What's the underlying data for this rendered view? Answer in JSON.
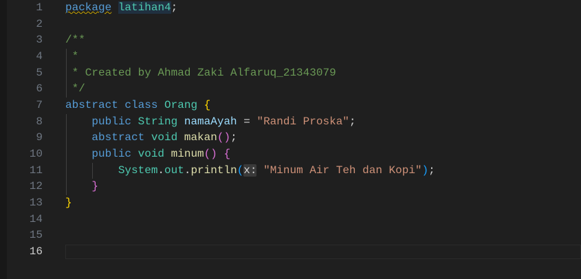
{
  "colors": {
    "keyword": "#569cd6",
    "type": "#4ec9b0",
    "variable": "#9cdcfe",
    "function": "#dcdcaa",
    "string": "#ce9178",
    "comment": "#6a9955",
    "plain": "#d4d4d4",
    "brace1": "#ffd700",
    "brace2": "#da70d6",
    "brace3": "#179fff"
  },
  "editor": {
    "active_line": 16,
    "lines": [
      {
        "n": "1",
        "tokens": [
          {
            "t": "package",
            "c": "keyword",
            "s": "squig"
          },
          {
            "t": " ",
            "c": "plain"
          },
          {
            "t": "latihan4",
            "c": "type",
            "s": "hl"
          },
          {
            "t": ";",
            "c": "plain"
          }
        ]
      },
      {
        "n": "2",
        "tokens": []
      },
      {
        "n": "3",
        "tokens": [
          {
            "t": "/**",
            "c": "comment"
          }
        ]
      },
      {
        "n": "4",
        "tokens": [
          {
            "t": " *",
            "c": "comment"
          }
        ]
      },
      {
        "n": "5",
        "tokens": [
          {
            "t": " * Created by Ahmad Zaki Alfaruq_21343079",
            "c": "comment"
          }
        ]
      },
      {
        "n": "6",
        "tokens": [
          {
            "t": " */",
            "c": "comment"
          }
        ]
      },
      {
        "n": "7",
        "tokens": [
          {
            "t": "abstract",
            "c": "keyword"
          },
          {
            "t": " ",
            "c": "plain"
          },
          {
            "t": "class",
            "c": "keyword"
          },
          {
            "t": " ",
            "c": "plain"
          },
          {
            "t": "Orang",
            "c": "type"
          },
          {
            "t": " ",
            "c": "plain"
          },
          {
            "t": "{",
            "c": "brace1"
          }
        ]
      },
      {
        "n": "8",
        "tokens": [
          {
            "t": "    ",
            "c": "plain"
          },
          {
            "t": "public",
            "c": "keyword"
          },
          {
            "t": " ",
            "c": "plain"
          },
          {
            "t": "String",
            "c": "type"
          },
          {
            "t": " ",
            "c": "plain"
          },
          {
            "t": "namaAyah",
            "c": "variable"
          },
          {
            "t": " = ",
            "c": "plain"
          },
          {
            "t": "\"Randi Proska\"",
            "c": "string"
          },
          {
            "t": ";",
            "c": "plain"
          }
        ]
      },
      {
        "n": "9",
        "tokens": [
          {
            "t": "    ",
            "c": "plain"
          },
          {
            "t": "abstract",
            "c": "keyword"
          },
          {
            "t": " ",
            "c": "plain"
          },
          {
            "t": "void",
            "c": "type"
          },
          {
            "t": " ",
            "c": "plain"
          },
          {
            "t": "makan",
            "c": "function"
          },
          {
            "t": "()",
            "c": "brace2"
          },
          {
            "t": ";",
            "c": "plain"
          }
        ]
      },
      {
        "n": "10",
        "tokens": [
          {
            "t": "    ",
            "c": "plain"
          },
          {
            "t": "public",
            "c": "keyword"
          },
          {
            "t": " ",
            "c": "plain"
          },
          {
            "t": "void",
            "c": "type"
          },
          {
            "t": " ",
            "c": "plain"
          },
          {
            "t": "minum",
            "c": "function"
          },
          {
            "t": "()",
            "c": "brace2"
          },
          {
            "t": " ",
            "c": "plain"
          },
          {
            "t": "{",
            "c": "brace2"
          }
        ]
      },
      {
        "n": "11",
        "tokens": [
          {
            "t": "        ",
            "c": "plain"
          },
          {
            "t": "System",
            "c": "type"
          },
          {
            "t": ".",
            "c": "plain"
          },
          {
            "t": "out",
            "c": "type"
          },
          {
            "t": ".",
            "c": "plain"
          },
          {
            "t": "println",
            "c": "function"
          },
          {
            "t": "(",
            "c": "brace3"
          },
          {
            "t": "x:",
            "c": "plain",
            "s": "hint"
          },
          {
            "t": " ",
            "c": "plain"
          },
          {
            "t": "\"Minum Air Teh dan Kopi\"",
            "c": "string"
          },
          {
            "t": ")",
            "c": "brace3"
          },
          {
            "t": ";",
            "c": "plain"
          }
        ]
      },
      {
        "n": "12",
        "tokens": [
          {
            "t": "    ",
            "c": "plain"
          },
          {
            "t": "}",
            "c": "brace2"
          }
        ]
      },
      {
        "n": "13",
        "tokens": [
          {
            "t": "}",
            "c": "brace1"
          }
        ]
      },
      {
        "n": "14",
        "tokens": []
      },
      {
        "n": "15",
        "tokens": []
      },
      {
        "n": "16",
        "tokens": []
      }
    ]
  }
}
